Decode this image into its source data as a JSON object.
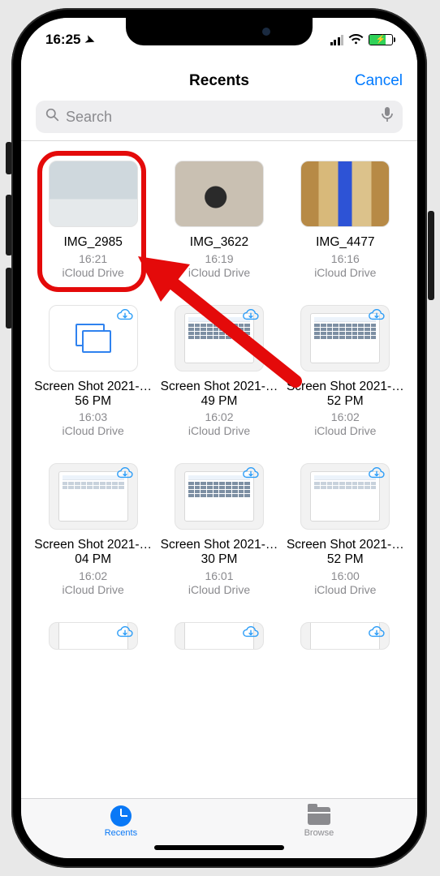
{
  "status": {
    "time": "16:25"
  },
  "nav": {
    "title": "Recents",
    "cancel": "Cancel"
  },
  "search": {
    "placeholder": "Search"
  },
  "files": [
    {
      "name": "IMG_2985",
      "time": "16:21",
      "loc": "iCloud Drive"
    },
    {
      "name": "IMG_3622",
      "time": "16:19",
      "loc": "iCloud Drive"
    },
    {
      "name": "IMG_4477",
      "time": "16:16",
      "loc": "iCloud Drive"
    },
    {
      "name": "Screen Shot 2021-…56 PM",
      "time": "16:03",
      "loc": "iCloud Drive"
    },
    {
      "name": "Screen Shot 2021-…49 PM",
      "time": "16:02",
      "loc": "iCloud Drive"
    },
    {
      "name": "Screen Shot 2021-…52 PM",
      "time": "16:02",
      "loc": "iCloud Drive"
    },
    {
      "name": "Screen Shot 2021-…04 PM",
      "time": "16:02",
      "loc": "iCloud Drive"
    },
    {
      "name": "Screen Shot 2021-…30 PM",
      "time": "16:01",
      "loc": "iCloud Drive"
    },
    {
      "name": "Screen Shot 2021-…52 PM",
      "time": "16:00",
      "loc": "iCloud Drive"
    }
  ],
  "tabs": {
    "recents": "Recents",
    "browse": "Browse"
  }
}
